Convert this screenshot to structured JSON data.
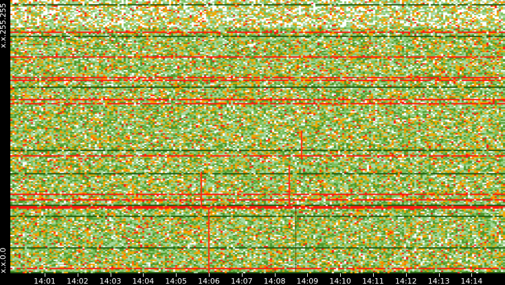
{
  "chart_data": {
    "type": "heatmap",
    "title": "",
    "xlabel": "",
    "ylabel": "",
    "y_tick_labels": [
      "x.x.255.255",
      "x.x.0.0"
    ],
    "x_tick_labels": [
      "14:01",
      "14:02",
      "14:03",
      "14:04",
      "14:05",
      "14:06",
      "14:07",
      "14:08",
      "14:09",
      "14:10",
      "14:11",
      "14:12",
      "14:13",
      "14:14"
    ],
    "color_scale": [
      "#ffffff",
      "#a8d8a0",
      "#7cc05a",
      "#4f9a2a",
      "#1f5a10",
      "#f0a800",
      "#ff6a00",
      "#ff1a10"
    ],
    "grid": false,
    "legend": "none"
  }
}
